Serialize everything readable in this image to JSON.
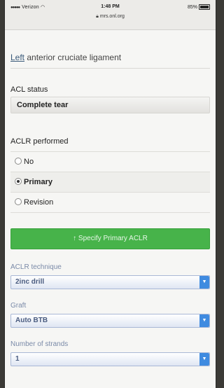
{
  "status_bar": {
    "carrier": "Verizon",
    "time": "1:48 PM",
    "battery": "85%",
    "url": "mrs.onl.org"
  },
  "page": {
    "heading_side": "Left",
    "heading_rest": " anterior cruciate ligament"
  },
  "acl_status": {
    "label": "ACL status",
    "value": "Complete tear"
  },
  "aclr_performed": {
    "label": "ACLR performed",
    "options": [
      "No",
      "Primary",
      "Revision"
    ],
    "selected": "Primary"
  },
  "primary_button": {
    "label": "↑ Specify Primary ACLR"
  },
  "technique": {
    "label": "ACLR technique",
    "value": "2inc drill"
  },
  "graft": {
    "label": "Graft",
    "value": "Auto BTB"
  },
  "strands": {
    "label": "Number of strands",
    "value": "1"
  },
  "colors": {
    "button_green": "#47b34a",
    "select_blue": "#3f8be0"
  }
}
